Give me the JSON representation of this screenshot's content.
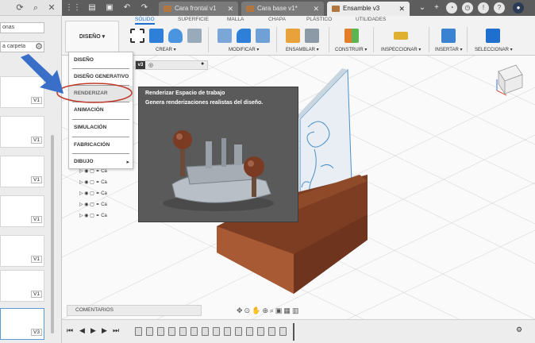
{
  "left_panel": {
    "upload_field": "onas",
    "folder_button": "a carpeta",
    "versions": [
      "V1",
      "V1",
      "V1",
      "V1",
      "V1",
      "V1",
      "V3"
    ]
  },
  "tabs": [
    {
      "label": "Cara frontal v1",
      "active": false
    },
    {
      "label": "Cara base v1*",
      "active": false
    },
    {
      "label": "Ensamble v3",
      "active": true
    }
  ],
  "toolbar": {
    "workspace_label": "DISEÑO ▾",
    "workspace_tabs": [
      "SÓLIDO",
      "SUPERFICIE",
      "MALLA",
      "CHAPA",
      "PLÁSTICO",
      "UTILIDADES"
    ],
    "active_tab": "SÓLIDO",
    "groups": [
      "CREAR ▾",
      "MODIFICAR ▾",
      "ENSAMBLAR ▾",
      "CONSTRUIR ▾",
      "INSPECCIONAR ▾",
      "INSERTAR ▾",
      "SELECCIONAR ▾"
    ]
  },
  "workspace_menu": {
    "items": [
      "DISEÑO",
      "DISEÑO GENERATIVO",
      "RENDERIZAR",
      "ANIMACIÓN",
      "SIMULACIÓN",
      "FABRICACIÓN",
      "DIBUJO"
    ],
    "highlighted": "RENDERIZAR",
    "submenu_arrow": "▸"
  },
  "tooltip": {
    "title": "Renderizar Espacio de trabajo",
    "description": "Genera renderizaciones realistas del diseño."
  },
  "browser": {
    "version_badge": "v3",
    "rows": [
      "Ca",
      "Ca",
      "Ca",
      "Ca",
      "Ca",
      "Ca",
      "Ca",
      "Ca"
    ]
  },
  "comments_label": "COMENTARIOS",
  "colors": {
    "tabbar": "#5d5d5d",
    "accent": "#1a6fd0",
    "tooltip_bg": "#5a5a5a",
    "highlight_ring": "#c0392b",
    "pointer_arrow": "#3a6fc9",
    "wood": "#8a4a2c"
  },
  "icons": [
    "grid-icon",
    "file-icon",
    "save-icon",
    "undo-icon",
    "redo-icon",
    "refresh-icon",
    "search-icon",
    "close-icon",
    "gear-icon",
    "help-icon",
    "user-icon",
    "viewcube-icon"
  ]
}
